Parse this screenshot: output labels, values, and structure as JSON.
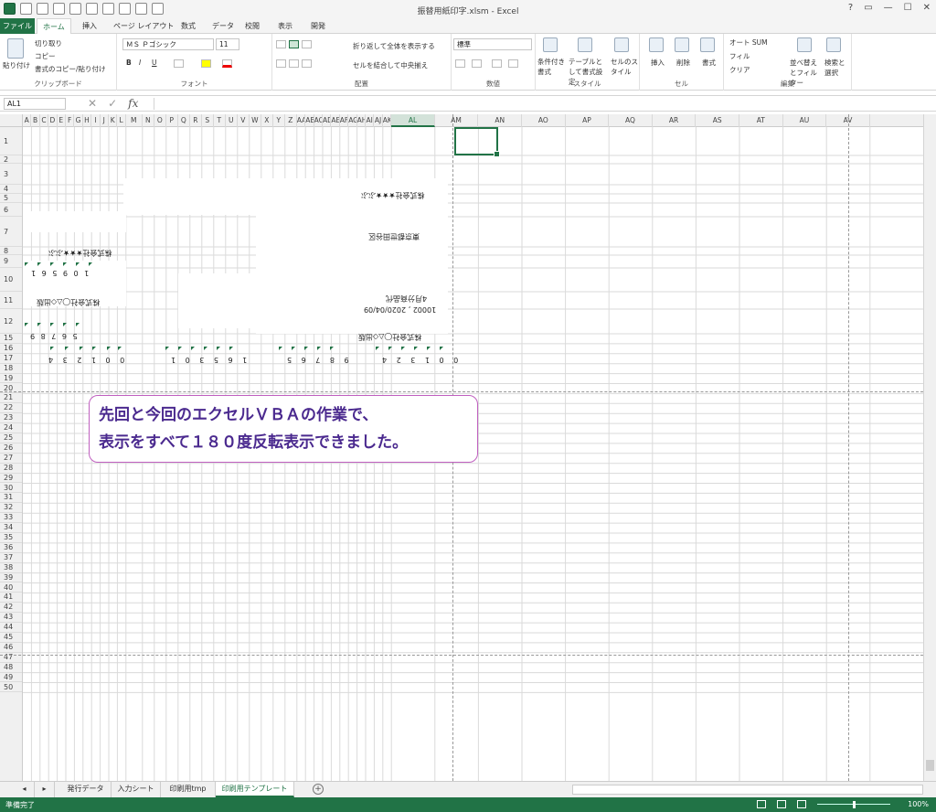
{
  "window": {
    "title": "振替用紙印字.xlsm - Excel",
    "controls": [
      "?",
      "▭",
      "—",
      "☐",
      "✕"
    ]
  },
  "tabs": [
    "ファイル",
    "ホーム",
    "挿入",
    "ページ レイアウト",
    "数式",
    "データ",
    "校閲",
    "表示",
    "開発"
  ],
  "ribbon": {
    "clipboard": {
      "paste": "貼り付け",
      "cut": "切り取り",
      "copy": "コピー",
      "format_painter": "書式のコピー/貼り付け",
      "label": "クリップボード"
    },
    "font": {
      "name": "ＭＳ Ｐゴシック",
      "size": "11",
      "label": "フォント",
      "bold": "B",
      "italic": "I",
      "underline": "U"
    },
    "align": {
      "wrap": "折り返して全体を表示する",
      "merge": "セルを結合して中央揃え",
      "label": "配置"
    },
    "number": {
      "format": "標準",
      "label": "数値"
    },
    "styles": {
      "cond": "条件付き書式",
      "table": "テーブルとして書式設定",
      "cell": "セルのスタイル",
      "label": "スタイル"
    },
    "cells": {
      "insert": "挿入",
      "delete": "削除",
      "format": "書式",
      "label": "セル"
    },
    "editing": {
      "autosum": "オート SUM",
      "fill": "フィル",
      "clear": "クリア",
      "sort": "並べ替えとフィルター",
      "find": "検索と選択",
      "label": "編集"
    }
  },
  "formula_bar": {
    "name_box": "AL1",
    "fx": "fx",
    "cancel": "✕",
    "enter": "✓",
    "value": ""
  },
  "columns": [
    "A",
    "B",
    "C",
    "D",
    "E",
    "F",
    "G",
    "H",
    "I",
    "J",
    "K",
    "L",
    "M",
    "N",
    "O",
    "P",
    "Q",
    "R",
    "S",
    "T",
    "U",
    "V",
    "W",
    "X",
    "Y",
    "Z",
    "AA",
    "AB",
    "AC",
    "AD",
    "AE",
    "AF",
    "AG",
    "AH",
    "AI",
    "AJ",
    "AK",
    "AL",
    "AM",
    "AN",
    "AO",
    "AP",
    "AQ",
    "AR",
    "AS",
    "AT",
    "AU",
    "AV"
  ],
  "rows": [
    "1",
    "2",
    "3",
    "4",
    "5",
    "6",
    "7",
    "8",
    "9",
    "10",
    "11",
    "12",
    "15",
    "16",
    "17",
    "18",
    "19",
    "20",
    "21",
    "22",
    "23",
    "24",
    "25",
    "26",
    "27",
    "28",
    "29",
    "30",
    "31",
    "32",
    "33",
    "34",
    "35",
    "36",
    "37",
    "38",
    "39",
    "40",
    "41",
    "42",
    "43",
    "44",
    "45",
    "46",
    "47",
    "48",
    "49",
    "50"
  ],
  "cells": {
    "t1": "株式会社★★★ぶぶ",
    "t2": "東京都世田谷区",
    "t3": "株式会社★★★ぶぶ",
    "t4": "1 0 9 5 6 1",
    "t5": "株式会社◯△◇出版",
    "t6": "4月分商品代",
    "t7": "10002 , 2020/04/09",
    "t8": "5 6 7 8 9",
    "t9": "株式会社◯△◇出版",
    "t10": "0 0 1 2 3 4",
    "t11": "1 6 5 3 0 1",
    "t12": "9 8 7 6 5",
    "t13": "0 0 1 3 2 4"
  },
  "callout": {
    "line1": "先回と今回のエクセルＶＢＡの作業で、",
    "line2": "表示をすべて１８０度反転表示できました。"
  },
  "sheets": [
    "発行データ",
    "入力シート",
    "印刷用tmp",
    "印刷用テンプレート"
  ],
  "active_sheet": "印刷用テンプレート",
  "status": {
    "ready": "準備完了",
    "zoom": "100%"
  }
}
